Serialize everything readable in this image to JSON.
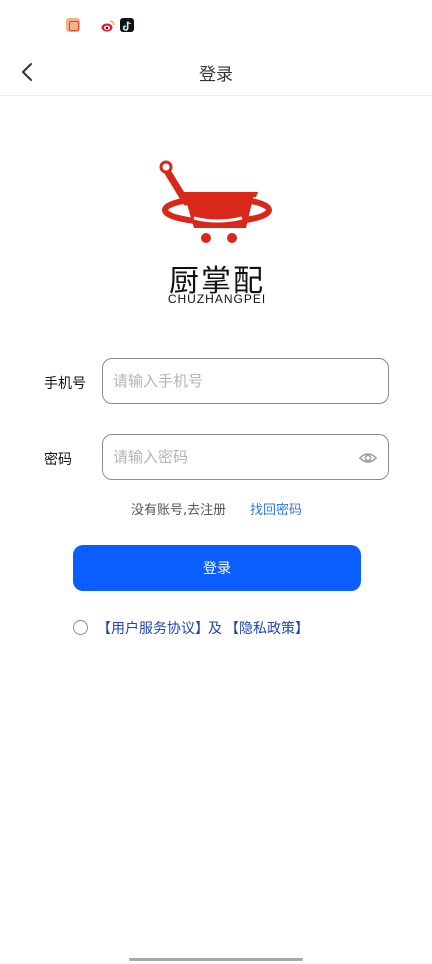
{
  "status_bar": {
    "icons": [
      "news-app-icon",
      "weibo-icon",
      "tiktok-icon"
    ]
  },
  "nav": {
    "back_icon": "chevron-left-icon",
    "title": "登录"
  },
  "logo": {
    "icon": "shopping-cart-wok-icon",
    "name_cn": "厨掌配",
    "name_en": "CHUZHANGPEI",
    "brand_color": "#d9271a"
  },
  "form": {
    "phone": {
      "label": "手机号",
      "placeholder": "请输入手机号",
      "value": ""
    },
    "password": {
      "label": "密码",
      "placeholder": "请输入密码",
      "value": "",
      "toggle_icon": "eye-icon"
    }
  },
  "links": {
    "register": "没有账号,去注册",
    "forgot": "找回密码"
  },
  "login_button": {
    "label": "登录",
    "color": "#0a5dff"
  },
  "agreement": {
    "checked": false,
    "terms": "【用户服务协议】",
    "and": "及",
    "privacy": "【隐私政策】",
    "link_color": "#1f45b6"
  }
}
